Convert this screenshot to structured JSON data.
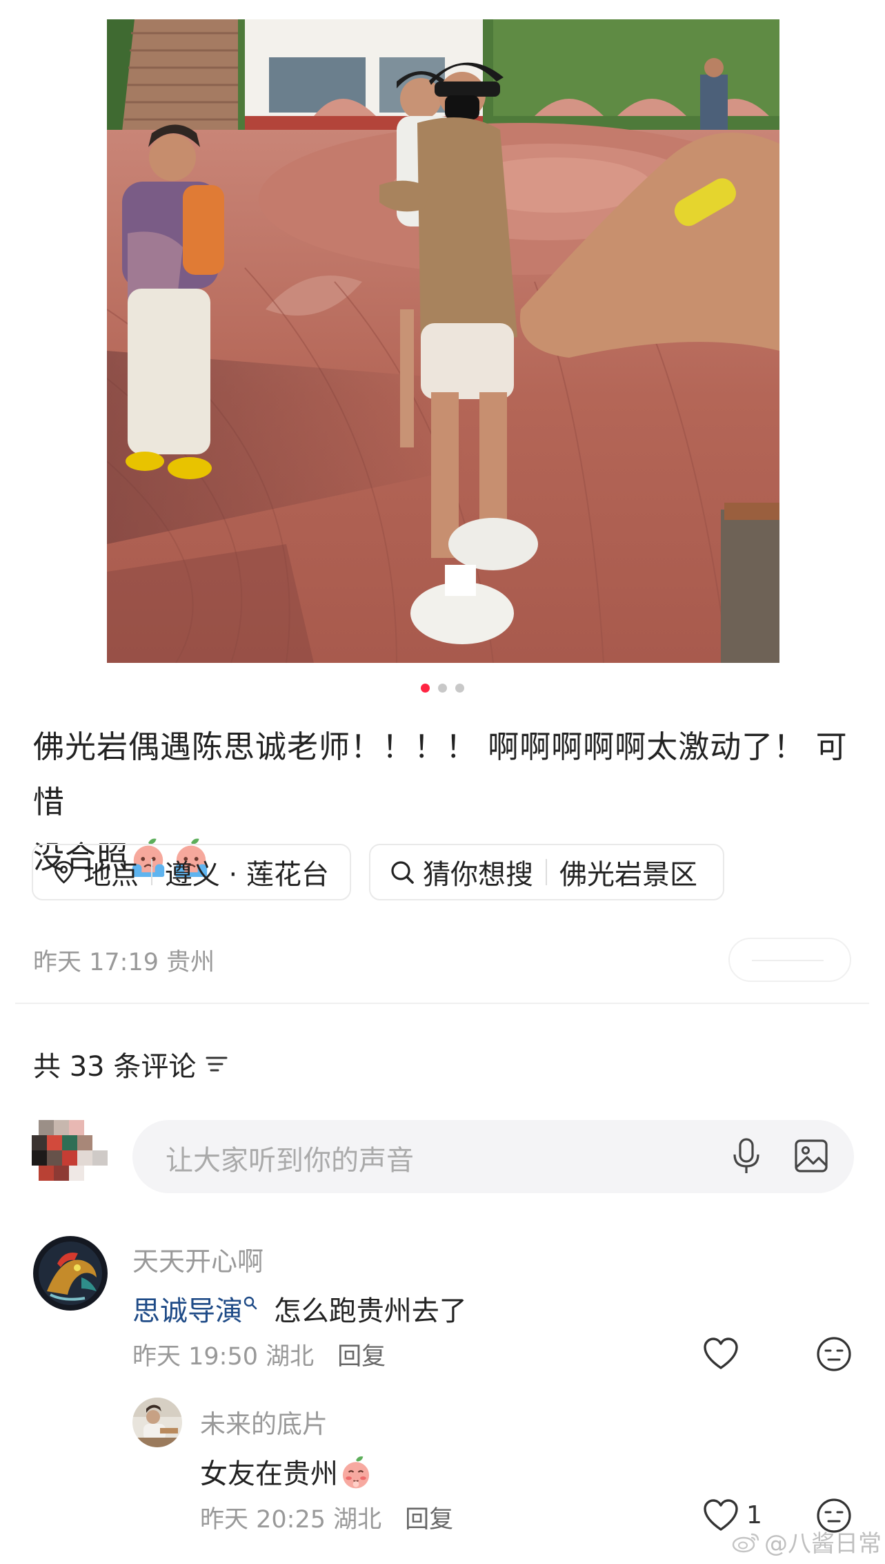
{
  "post": {
    "image_count": 3,
    "active_image_index": 0,
    "text_line1": "佛光岩偶遇陈思诚老师！！！！ 啊啊啊啊啊太激动了！ 可惜",
    "text_line2": "没合照",
    "text_emojis": [
      "crying-peach-emoji",
      "crying-peach-emoji"
    ],
    "location_tag": {
      "label": "地点",
      "value": "遵义 · 莲花台"
    },
    "search_tag": {
      "label": "猜你想搜",
      "value": "佛光岩景区"
    },
    "meta": "昨天 17:19 贵州"
  },
  "comments_header": {
    "title": "共 33 条评论"
  },
  "comment_input": {
    "placeholder": "让大家听到你的声音"
  },
  "comments": [
    {
      "user": "天天开心啊",
      "mention": "思诚导演",
      "text": " 怎么跑贵州去了",
      "time": "昨天 19:50 湖北",
      "reply_label": "回复",
      "likes": ""
    },
    {
      "user": "未来的底片",
      "text": "女友在贵州",
      "emoji": "shy-peach-emoji",
      "time": "昨天 20:25 湖北",
      "reply_label": "回复",
      "likes": "1"
    }
  ],
  "watermark": "@八酱日常",
  "colors": {
    "accent": "#ff2442",
    "mention": "#1f4b87",
    "muted_text": "#999999",
    "input_bg": "#f4f4f6"
  }
}
